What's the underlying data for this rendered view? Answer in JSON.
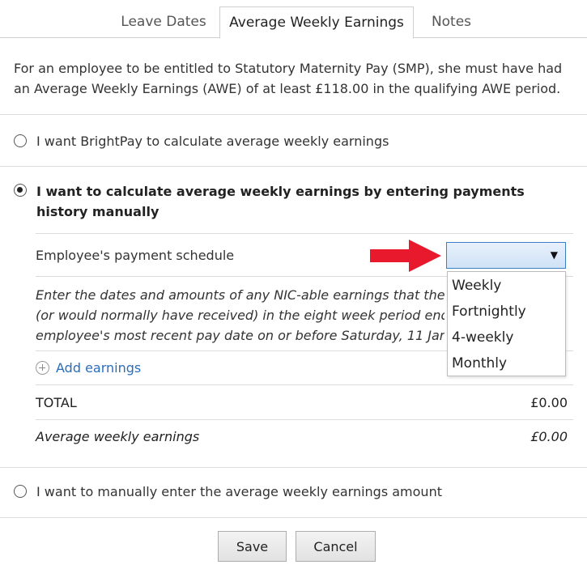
{
  "tabs": [
    {
      "label": "Leave Dates"
    },
    {
      "label": "Average Weekly Earnings"
    },
    {
      "label": "Notes"
    }
  ],
  "intro_text": "For an employee to be entitled to Statutory Maternity Pay (SMP), she must have had an Average Weekly Earnings (AWE) of at least £118.00 in the qualifying AWE period.",
  "options": {
    "auto": "I want BrightPay to calculate average weekly earnings",
    "manual_history": "I want to calculate average weekly earnings by entering payments history manually",
    "manual_amount": "I want to manually enter the average weekly earnings amount"
  },
  "schedule": {
    "label": "Employee's payment schedule",
    "selected": "",
    "dropdown_options": [
      "Weekly",
      "Fortnightly",
      "4-weekly",
      "Monthly"
    ]
  },
  "instructions": {
    "line1": "Enter the dates and amounts of any NIC-able earnings that the e",
    "line2": "(or would normally have received) in the eight week period endir",
    "line3": "employee's most recent pay date on or before Saturday, 11 Janua"
  },
  "add_earnings_label": "Add earnings",
  "total": {
    "label": "TOTAL",
    "value": "£0.00"
  },
  "average": {
    "label": "Average weekly earnings",
    "value": "£0.00"
  },
  "buttons": {
    "save": "Save",
    "cancel": "Cancel"
  },
  "colors": {
    "link": "#2a6ebb",
    "arrow": "#e8192c",
    "select_border": "#3c7fc6"
  }
}
